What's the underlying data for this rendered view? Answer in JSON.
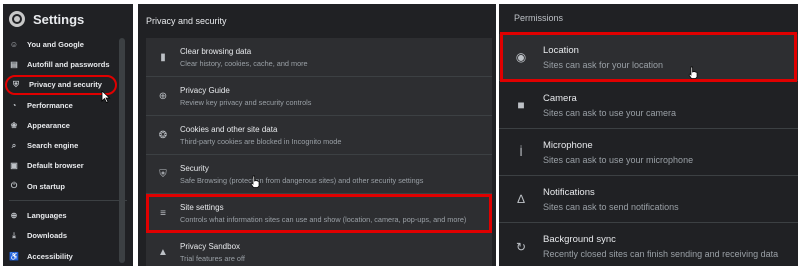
{
  "sidebar": {
    "title": "Settings",
    "items": [
      {
        "label": "You and Google",
        "icon": "person-icon",
        "glyph": "☺"
      },
      {
        "label": "Autofill and passwords",
        "icon": "clipboard-icon",
        "glyph": "▤"
      },
      {
        "label": "Privacy and security",
        "icon": "shield-icon",
        "glyph": "⛨"
      },
      {
        "label": "Performance",
        "icon": "speedometer-icon",
        "glyph": "◔"
      },
      {
        "label": "Appearance",
        "icon": "palette-icon",
        "glyph": "❀"
      },
      {
        "label": "Search engine",
        "icon": "search-icon",
        "glyph": "⌕"
      },
      {
        "label": "Default browser",
        "icon": "browser-icon",
        "glyph": "▣"
      },
      {
        "label": "On startup",
        "icon": "power-icon",
        "glyph": "⏻"
      },
      {
        "label": "Languages",
        "icon": "globe-icon",
        "glyph": "⊕"
      },
      {
        "label": "Downloads",
        "icon": "download-icon",
        "glyph": "⤓"
      },
      {
        "label": "Accessibility",
        "icon": "accessibility-icon",
        "glyph": "♿"
      }
    ]
  },
  "privacy": {
    "header": "Privacy and security",
    "rows": [
      {
        "title": "Clear browsing data",
        "subtitle": "Clear history, cookies, cache, and more",
        "icon": "trash-icon",
        "glyph": "▮"
      },
      {
        "title": "Privacy Guide",
        "subtitle": "Review key privacy and security controls",
        "icon": "compass-icon",
        "glyph": "⊕"
      },
      {
        "title": "Cookies and other site data",
        "subtitle": "Third-party cookies are blocked in Incognito mode",
        "icon": "cookie-icon",
        "glyph": "❂"
      },
      {
        "title": "Security",
        "subtitle": "Safe Browsing (protection from dangerous sites) and other security settings",
        "icon": "security-shield-icon",
        "glyph": "⛨"
      },
      {
        "title": "Site settings",
        "subtitle": "Controls what information sites can use and show (location, camera, pop-ups, and more)",
        "icon": "sliders-icon",
        "glyph": "≡"
      },
      {
        "title": "Privacy Sandbox",
        "subtitle": "Trial features are off",
        "icon": "sandbox-icon",
        "glyph": "▲"
      }
    ]
  },
  "permissions": {
    "header": "Permissions",
    "rows": [
      {
        "title": "Location",
        "subtitle": "Sites can ask for your location",
        "icon": "location-pin-icon",
        "glyph": "◉"
      },
      {
        "title": "Camera",
        "subtitle": "Sites can ask to use your camera",
        "icon": "camera-icon",
        "glyph": "■"
      },
      {
        "title": "Microphone",
        "subtitle": "Sites can ask to use your microphone",
        "icon": "microphone-icon",
        "glyph": "İ"
      },
      {
        "title": "Notifications",
        "subtitle": "Sites can ask to send notifications",
        "icon": "bell-icon",
        "glyph": "∆"
      },
      {
        "title": "Background sync",
        "subtitle": "Recently closed sites can finish sending and receiving data",
        "icon": "sync-icon",
        "glyph": "↻"
      }
    ]
  },
  "colors": {
    "panel_bg": "#202124",
    "card_bg": "#2d2e31",
    "highlight": "#e00000",
    "text": "#e8eaed",
    "subtext": "#9aa0a6"
  }
}
